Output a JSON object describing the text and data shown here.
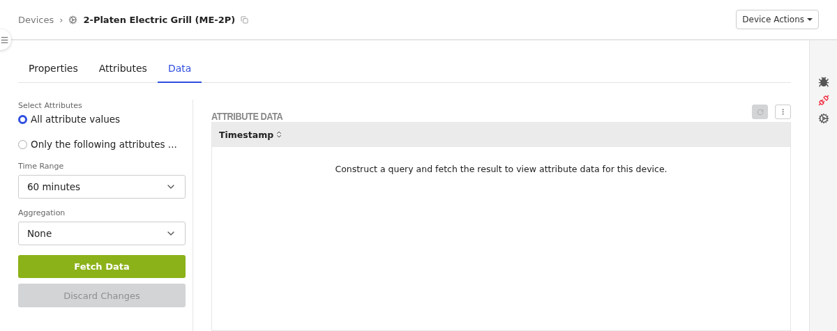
{
  "breadcrumb": {
    "parent": "Devices",
    "separator": "›",
    "title": "2-Platen Electric Grill (ME-2P)"
  },
  "device_actions": "Device Actions",
  "tabs": [
    {
      "label": "Properties",
      "selected": false
    },
    {
      "label": "Attributes",
      "selected": false
    },
    {
      "label": "Data",
      "selected": true
    }
  ],
  "query": {
    "select_label": "Select Attributes",
    "options": [
      {
        "label": "All attribute values",
        "selected": true
      },
      {
        "label": "Only the following attributes ...",
        "selected": false
      }
    ],
    "time_range": {
      "label": "Time Range",
      "value": "60 minutes"
    },
    "aggregation": {
      "label": "Aggregation",
      "value": "None"
    },
    "fetch_button": "Fetch Data",
    "discard_button": {
      "label": "Discard Changes",
      "disabled": true
    }
  },
  "results": {
    "title": "ATTRIBUTE DATA",
    "refresh_disabled": true,
    "columns": [
      "Timestamp"
    ],
    "empty_message": "Construct a query and fetch the result to view attribute data for this device."
  }
}
